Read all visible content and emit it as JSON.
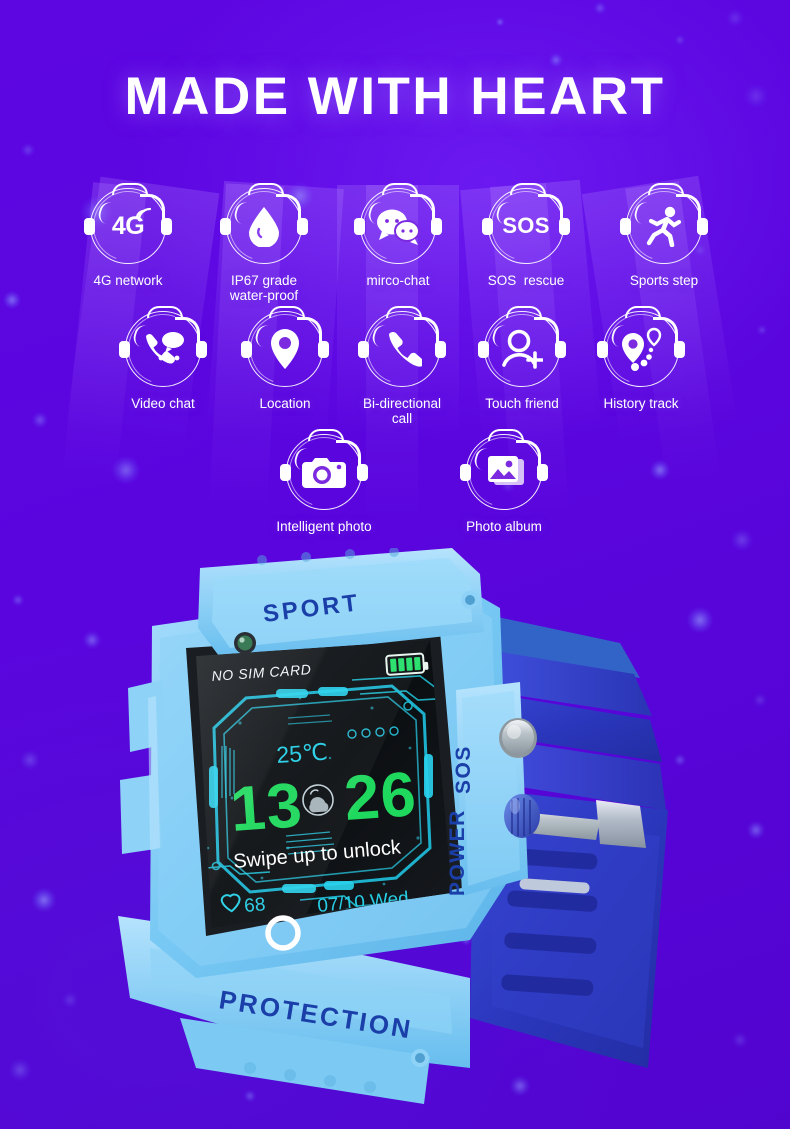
{
  "headline": "MADE WITH HEART",
  "theme": {
    "background_purple": "#5a05de",
    "accent_white": "#ffffff",
    "watch_body_blue": "#74c8f5",
    "watch_strap_blue": "#2f3fcf",
    "screen_cyan": "#23c9e0",
    "screen_green": "#1fd95e"
  },
  "features": [
    {
      "icon": "4g-network-icon",
      "label": "4G network",
      "glyph": "4G",
      "row": 1
    },
    {
      "icon": "water-drop-icon",
      "label": "IP67 grade\nwater-proof",
      "glyph": "drop",
      "row": 1
    },
    {
      "icon": "chat-bubbles-icon",
      "label": "mirco-chat",
      "glyph": "chat",
      "row": 1
    },
    {
      "icon": "sos-rescue-icon",
      "label": "SOS  rescue",
      "glyph": "SOS",
      "row": 1
    },
    {
      "icon": "running-person-icon",
      "label": "Sports step",
      "glyph": "run",
      "row": 1
    },
    {
      "icon": "video-chat-icon",
      "label": "Video chat",
      "glyph": "videochat",
      "row": 2
    },
    {
      "icon": "location-pin-icon",
      "label": "Location",
      "glyph": "pin",
      "row": 2
    },
    {
      "icon": "phone-call-icon",
      "label": "Bi-directional\ncall",
      "glyph": "phone",
      "row": 2
    },
    {
      "icon": "add-friend-icon",
      "label": "Touch friend",
      "glyph": "adduser",
      "row": 2
    },
    {
      "icon": "history-track-icon",
      "label": "History track",
      "glyph": "track",
      "row": 2
    },
    {
      "icon": "camera-icon",
      "label": "Intelligent photo",
      "glyph": "camera",
      "row": 3
    },
    {
      "icon": "photo-album-icon",
      "label": "Photo album",
      "glyph": "album",
      "row": 3
    }
  ],
  "watch": {
    "top_band_text": "SPORT",
    "bottom_band_text": "PROTECTION",
    "side_labels": {
      "sos": "SOS",
      "power": "POWER"
    },
    "screen": {
      "sim_status": "NO SIM CARD",
      "temperature": "25℃",
      "hour": "13",
      "minute": "26",
      "unlock_hint": "Swipe up to unlock",
      "heart_rate": "68",
      "date": "07/10 Wed",
      "battery_bars": 4
    }
  }
}
